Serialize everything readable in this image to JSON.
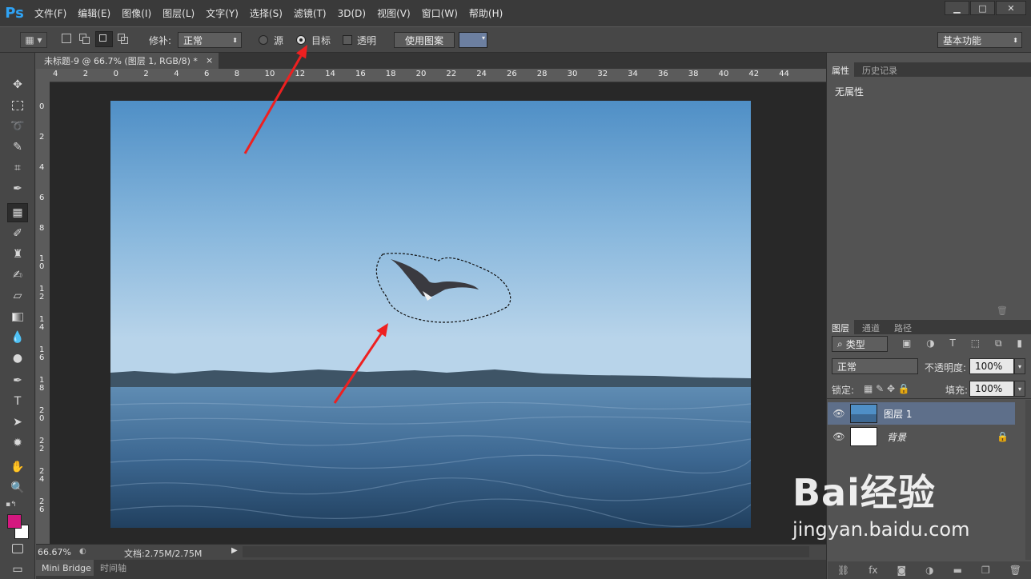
{
  "app": {
    "logo": "Ps"
  },
  "menu": [
    "文件(F)",
    "编辑(E)",
    "图像(I)",
    "图层(L)",
    "文字(Y)",
    "选择(S)",
    "滤镜(T)",
    "3D(D)",
    "视图(V)",
    "窗口(W)",
    "帮助(H)"
  ],
  "window_controls": {
    "minimize": "▁",
    "maximize": "□",
    "close": "✕"
  },
  "options": {
    "patch_label": "修补:",
    "patch_mode": "正常",
    "source_label": "源",
    "target_label": "目标",
    "transparent_label": "透明",
    "use_pattern_label": "使用图案",
    "workspace": "基本功能"
  },
  "document": {
    "tab_title": "未标题-9 @ 66.7% (图层 1, RGB/8) *",
    "close": "×",
    "ruler_h": [
      "4",
      "2",
      "0",
      "2",
      "4",
      "6",
      "8",
      "10",
      "12",
      "14",
      "16",
      "18",
      "20",
      "22",
      "24",
      "26",
      "28",
      "30",
      "32",
      "34",
      "36",
      "38",
      "40",
      "42",
      "44"
    ],
    "ruler_v": [
      "0",
      "2",
      "4",
      "6",
      "8",
      "10",
      "12",
      "14",
      "16",
      "18",
      "20",
      "22",
      "24",
      "26"
    ]
  },
  "status": {
    "zoom": "66.67%",
    "doc_info": "文档:2.75M/2.75M"
  },
  "bottom_tabs": [
    "Mini Bridge",
    "时间轴"
  ],
  "properties_panel": {
    "tabs": [
      "属性",
      "历史记录"
    ],
    "content": "无属性"
  },
  "layers_panel": {
    "tabs": [
      "图层",
      "通道",
      "路径"
    ],
    "filter_kind": "类型",
    "blend_mode": "正常",
    "opacity_label": "不透明度:",
    "opacity_value": "100%",
    "lock_label": "锁定:",
    "fill_label": "填充:",
    "fill_value": "100%",
    "layers": [
      {
        "name": "图层 1",
        "selected": true
      },
      {
        "name": "背景",
        "locked": true
      }
    ]
  },
  "colors": {
    "foreground": "#d4187f",
    "background": "#ffffff",
    "accent": "#2fa3f5",
    "arrow": "#ee2020"
  },
  "watermark": {
    "line1": "Bai经验",
    "line2": "jingyan.baidu.com"
  }
}
